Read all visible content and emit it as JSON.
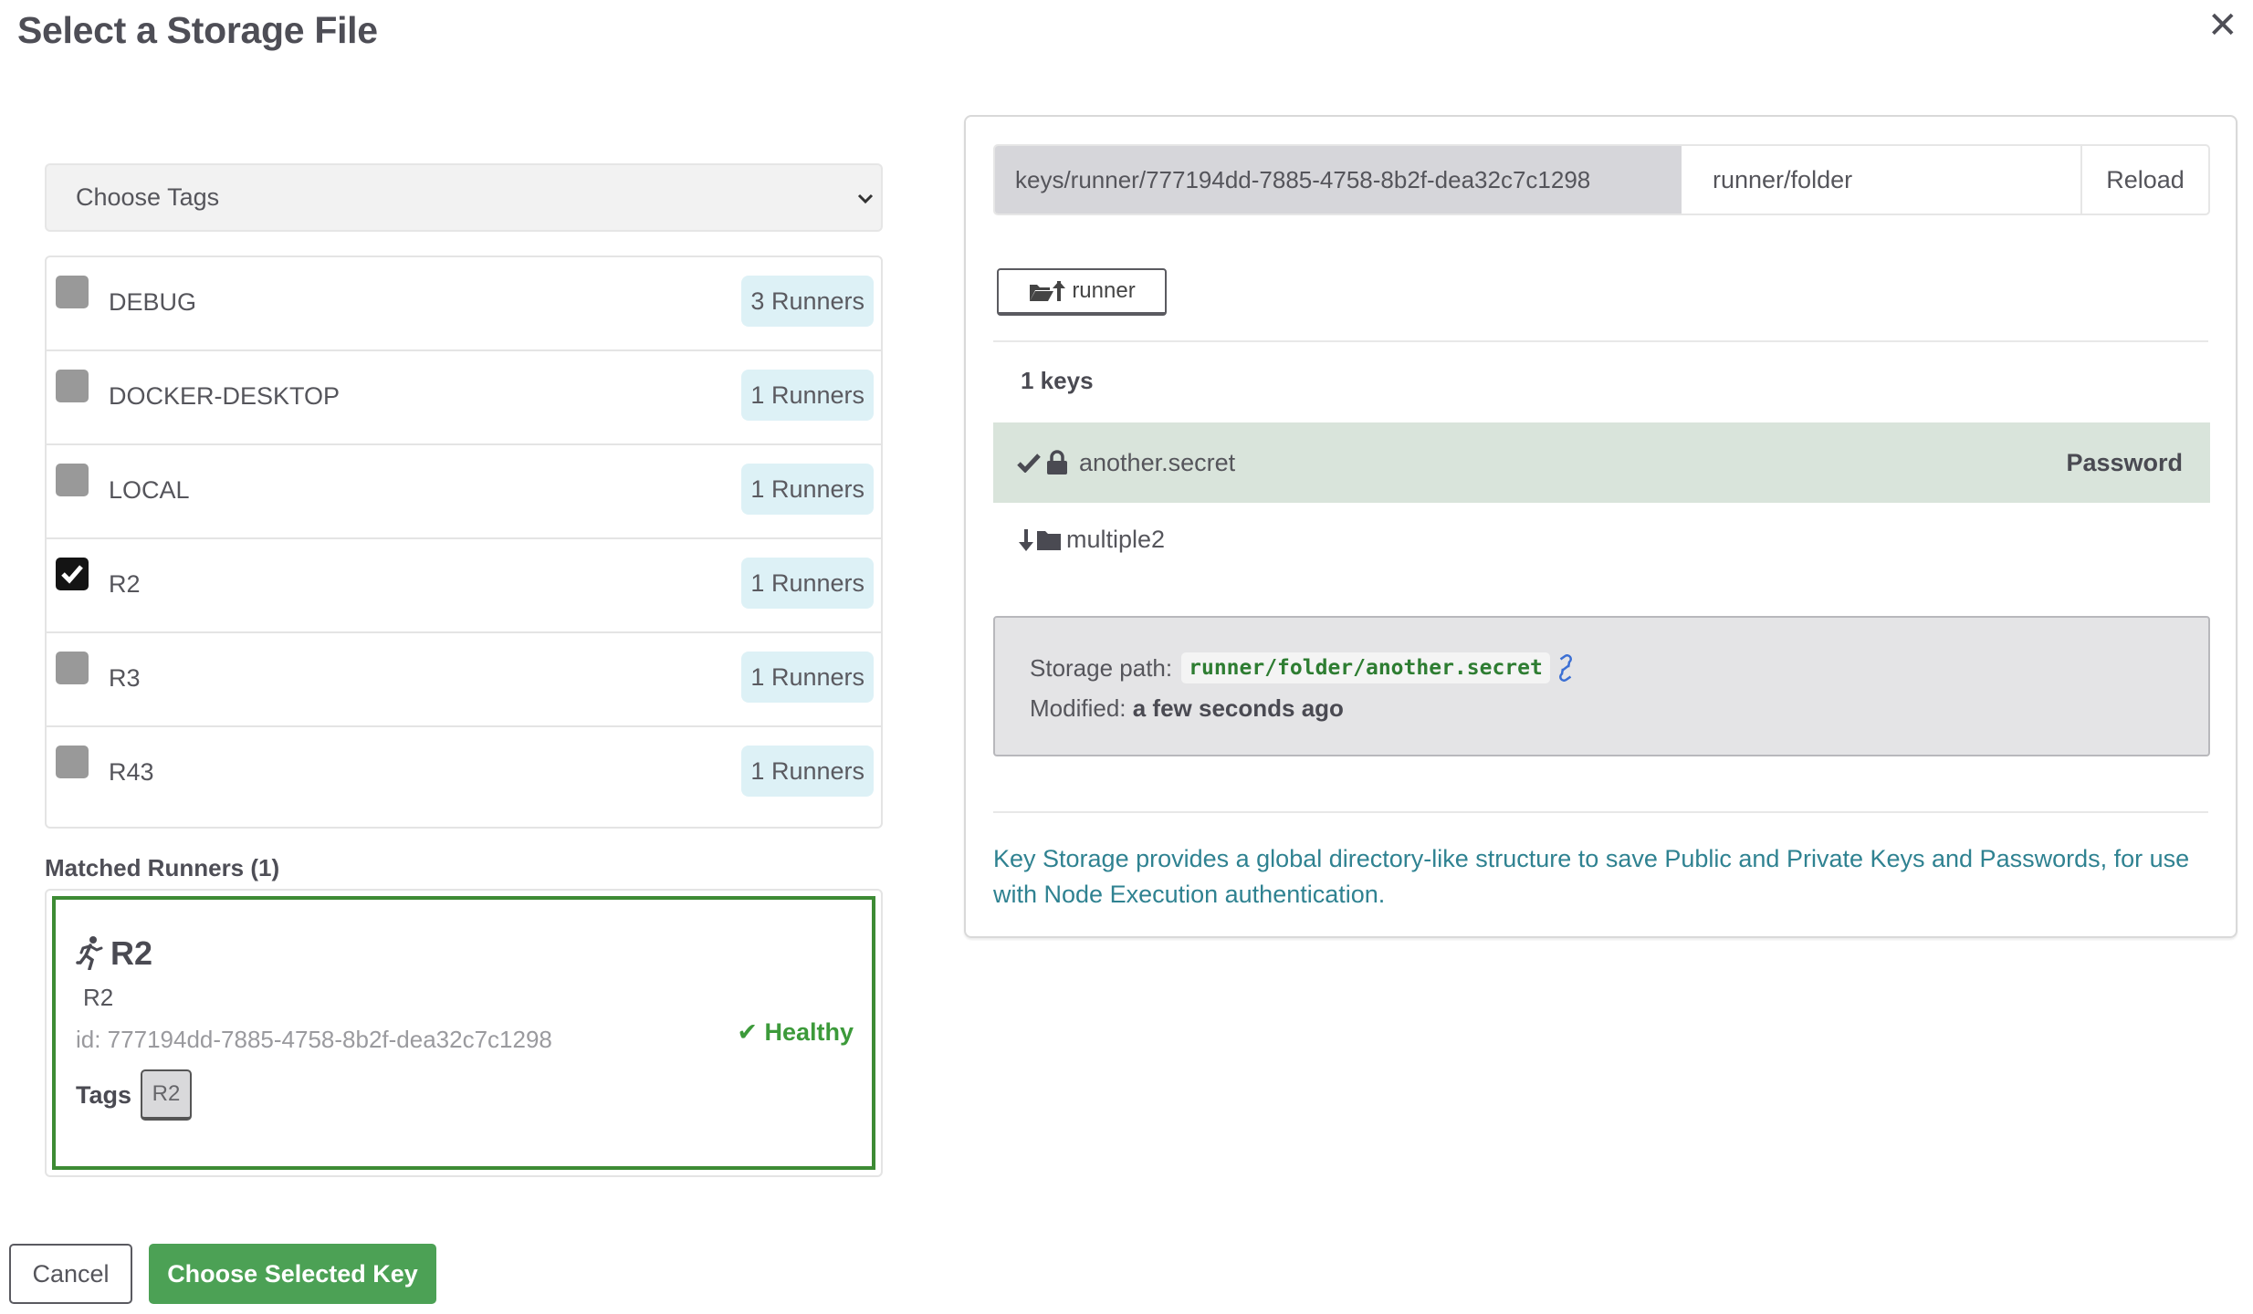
{
  "dialog": {
    "title": "Select a Storage File",
    "close_icon": "close-icon"
  },
  "tags": {
    "select_placeholder": "Choose Tags",
    "items": [
      {
        "name": "DEBUG",
        "count": "3 Runners",
        "checked": false
      },
      {
        "name": "DOCKER-DESKTOP",
        "count": "1 Runners",
        "checked": false
      },
      {
        "name": "LOCAL",
        "count": "1 Runners",
        "checked": false
      },
      {
        "name": "R2",
        "count": "1 Runners",
        "checked": true
      },
      {
        "name": "R3",
        "count": "1 Runners",
        "checked": false
      },
      {
        "name": "R43",
        "count": "1 Runners",
        "checked": false
      }
    ]
  },
  "matched": {
    "label": "Matched Runners (1)",
    "runner": {
      "name": "R2",
      "description": "R2",
      "id": "id: 777194dd-7885-4758-8b2f-dea32c7c1298",
      "status": "Healthy",
      "tags_label": "Tags",
      "tags": [
        "R2"
      ]
    }
  },
  "footer": {
    "cancel_label": "Cancel",
    "choose_label": "Choose Selected Key"
  },
  "storage": {
    "path_prefix": "keys/runner/777194dd-7885-4758-8b2f-dea32c7c1298",
    "path_value": "runner/folder",
    "reload_label": "Reload",
    "up_label": "runner",
    "keys_count": "1 keys",
    "keys": [
      {
        "name": "another.secret",
        "type": "Password",
        "selected": true
      }
    ],
    "folders": [
      {
        "name": "multiple2"
      }
    ],
    "info": {
      "path_label": "Storage path:",
      "path_value": "runner/folder/another.secret",
      "modified_label": "Modified:",
      "modified_value": "a few seconds ago"
    },
    "description": "Key Storage provides a global directory-like structure to save Public and Private Keys and Passwords, for use with Node Execution authentication."
  },
  "colors": {
    "accent_green": "#4ca155",
    "runner_border": "#3d8b34",
    "healthy": "#3c9a3a",
    "badge_bg": "#ddf1f6",
    "selected_row": "#d9e4db",
    "description_text": "#2f8291"
  }
}
